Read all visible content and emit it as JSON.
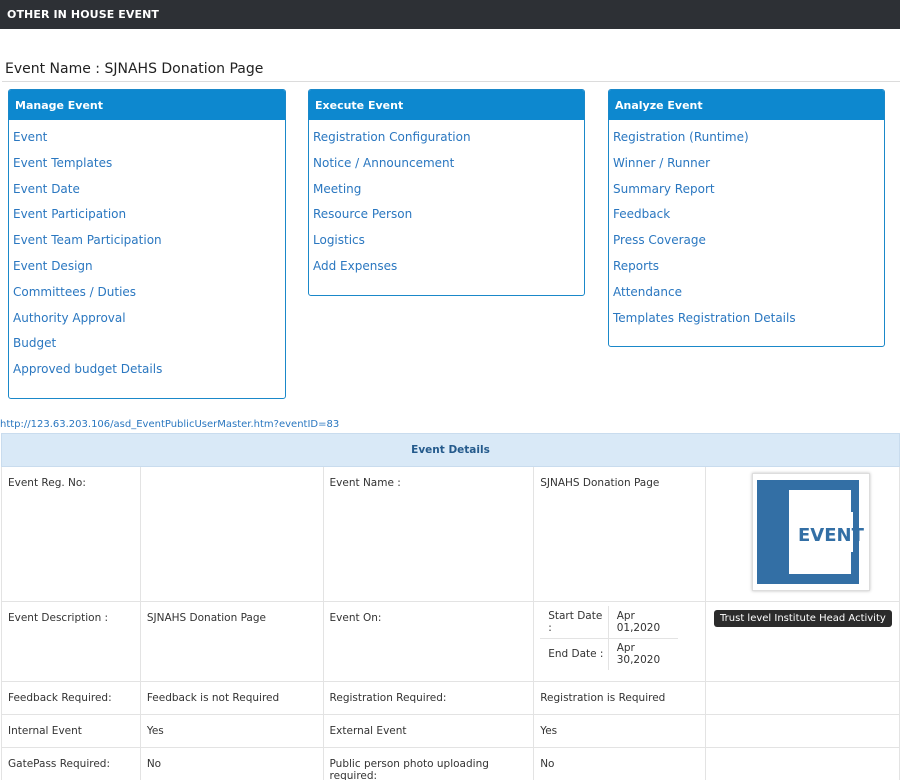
{
  "header": {
    "title": "OTHER IN HOUSE EVENT"
  },
  "event_name_line": "Event Name : SJNAHS Donation Page",
  "panels": {
    "manage": {
      "title": "Manage Event",
      "items": [
        "Event",
        "Event Templates",
        "Event Date",
        "Event Participation",
        "Event Team Participation",
        "Event Design",
        "Committees / Duties",
        "Authority Approval",
        "Budget",
        "Approved budget Details"
      ]
    },
    "execute": {
      "title": "Execute Event",
      "items": [
        "Registration Configuration",
        "Notice / Announcement",
        "Meeting",
        "Resource Person",
        "Logistics",
        "Add Expenses"
      ]
    },
    "analyze": {
      "title": "Analyze Event",
      "items": [
        "Registration (Runtime)",
        "Winner / Runner",
        "Summary Report",
        "Feedback",
        "Press Coverage",
        "Reports",
        "Attendance",
        "Templates Registration Details"
      ]
    }
  },
  "url_text": "http://123.63.203.106/asd_EventPublicUserMaster.htm?eventID=83",
  "details": {
    "heading": "Event Details",
    "reg_no_label": "Event Reg. No:",
    "reg_no_value": "",
    "event_name_label": "Event Name :",
    "event_name_value": "SJNAHS Donation Page",
    "logo": {
      "text": "EVENT",
      "color": "#336fa5"
    },
    "description_label": "Event Description :",
    "description_value": "SJNAHS Donation Page",
    "event_on_label": "Event On:",
    "start_label": "Start Date :",
    "start_value": "Apr 01,2020",
    "end_label": "End Date :",
    "end_value": "Apr 30,2020",
    "badge": "Trust level Institute Head Activity",
    "feedback_label": "Feedback Required:",
    "feedback_value": "Feedback is not Required",
    "registration_label": "Registration Required:",
    "registration_value": "Registration is Required",
    "internal_label": "Internal Event",
    "internal_value": "Yes",
    "external_label": "External Event",
    "external_value": "Yes",
    "gatepass_label": "GatePass Required:",
    "gatepass_value": "No",
    "photo_label": "Public person photo uploading required:",
    "photo_value": "No"
  }
}
